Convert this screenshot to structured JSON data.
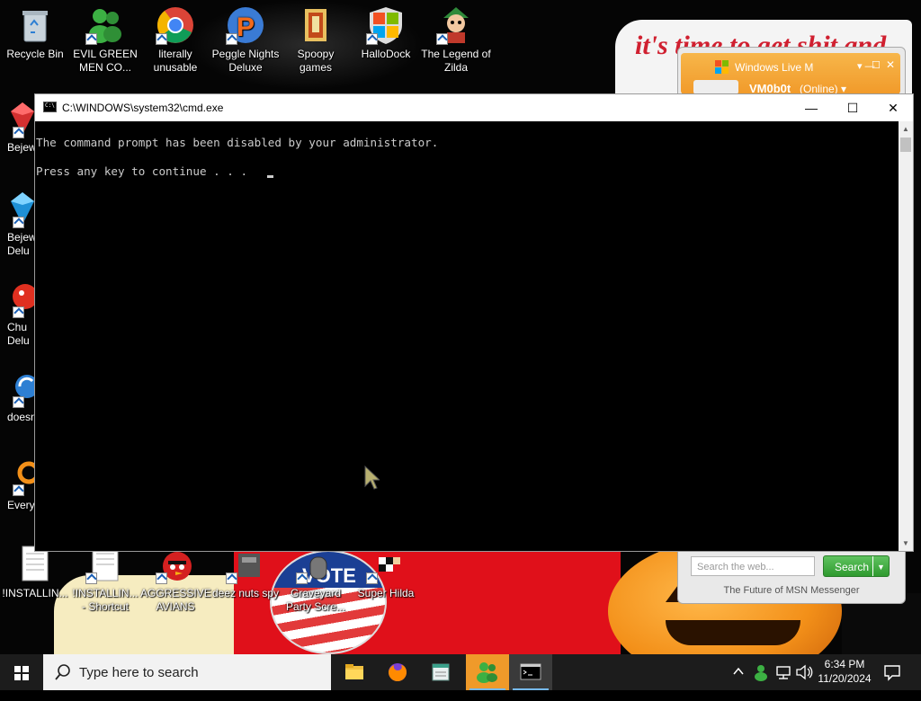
{
  "desktop": {
    "icons": [
      {
        "label": "Recycle Bin"
      },
      {
        "label": "EVIL GREEN MEN CO..."
      },
      {
        "label": "literally unusable"
      },
      {
        "label": "Peggle Nights Deluxe"
      },
      {
        "label": "Spoopy games"
      },
      {
        "label": "HalloDock"
      },
      {
        "label": "The Legend of Zilda"
      },
      {
        "label": "Bejew Delu"
      },
      {
        "label": "Bejew Delu"
      },
      {
        "label": "Chu Delu"
      },
      {
        "label": "doesn"
      },
      {
        "label": "Every"
      },
      {
        "label": "!INSTALLIN..."
      },
      {
        "label": "!INSTALLIN... - Shortcut"
      },
      {
        "label": "AGGRESSIVE AVIANS"
      },
      {
        "label": "deez nuts spy"
      },
      {
        "label": "Graveyard Party Scre..."
      },
      {
        "label": "Super Hilda"
      }
    ],
    "wallpaper_text": "it's time to get shit and",
    "vote_text": "VOTE"
  },
  "msn": {
    "title": "Windows Live M",
    "username": "VM0b0t",
    "status": "(Online) ▾",
    "search_placeholder": "Search the web...",
    "search_button": "Search",
    "footer": "The Future of MSN Messenger"
  },
  "cmd": {
    "title": "C:\\WINDOWS\\system32\\cmd.exe",
    "minimize": "—",
    "maximize": "☐",
    "close": "✕",
    "lines": [
      "The command prompt has been disabled by your administrator.",
      "Press any key to continue . . ."
    ]
  },
  "taskbar": {
    "search_placeholder": "Type here to search",
    "apps": [
      "file-explorer",
      "firefox",
      "notepad",
      "msn-messenger",
      "cmd"
    ],
    "clock_time": "6:34 PM",
    "clock_date": "11/20/2024"
  },
  "colors": {
    "console_bg": "#000000",
    "console_text": "#cccccc",
    "msn_orange": "#f19a2a",
    "taskbar": "#1c1c1c",
    "msn_search_green": "#2f9a2f"
  }
}
